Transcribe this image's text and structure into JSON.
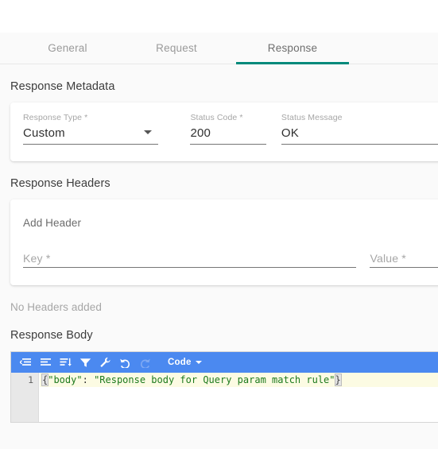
{
  "tabs": [
    {
      "id": "general",
      "label": "General",
      "active": false
    },
    {
      "id": "request",
      "label": "Request",
      "active": false
    },
    {
      "id": "response",
      "label": "Response",
      "active": true
    }
  ],
  "colors": {
    "accent_tab_underline": "#00897b",
    "editor_toolbar": "#4b89f0",
    "code_string": "#1d7a1d",
    "page_background": "#fafafa",
    "card_background": "#ffffff"
  },
  "response_metadata": {
    "section_title": "Response Metadata",
    "response_type": {
      "label": "Response Type *",
      "value": "Custom",
      "options": [
        "Custom"
      ]
    },
    "status_code": {
      "label": "Status Code *",
      "value": "200"
    },
    "status_message": {
      "label": "Status Message",
      "value": "OK"
    }
  },
  "response_headers": {
    "section_title": "Response Headers",
    "add_header_title": "Add Header",
    "key_field": {
      "label": "Key *",
      "value": "",
      "placeholder": "Key *"
    },
    "value_field": {
      "label": "Value *",
      "value": "",
      "placeholder": "Value *"
    },
    "empty_state": "No Headers added"
  },
  "response_body": {
    "section_title": "Response Body",
    "toolbar": {
      "icons": [
        "compact-icon",
        "format-icon",
        "sort-icon",
        "filter-icon",
        "transform-wrench-icon",
        "undo-icon",
        "redo-icon"
      ],
      "mode_label": "Code"
    },
    "editor": {
      "line_number": "1",
      "code": "{\"body\": \"Response body for Query param match rule\"}",
      "tokens": {
        "open_brace": "{",
        "key": "\"body\"",
        "colon": ":",
        "space": " ",
        "string": "\"Response body for Query param match rule\"",
        "close_brace": "}"
      }
    }
  }
}
